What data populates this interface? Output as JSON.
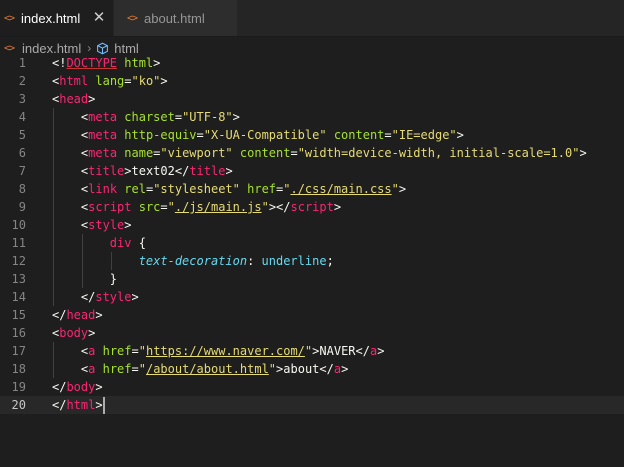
{
  "tabs": [
    {
      "label": "index.html",
      "active": true,
      "icon": "html-file-icon"
    },
    {
      "label": "about.html",
      "active": false,
      "icon": "html-file-icon"
    }
  ],
  "breadcrumb": {
    "file": "index.html",
    "symbol": "html"
  },
  "editor": {
    "current_line": 20,
    "lines": [
      [
        {
          "t": "<!",
          "c": "punc"
        },
        {
          "t": "DOCTYPE",
          "c": "tag"
        },
        {
          "t": " html",
          "c": "attr"
        },
        {
          "t": ">",
          "c": "punc"
        }
      ],
      [
        {
          "t": "<",
          "c": "punc"
        },
        {
          "t": "html",
          "c": "tag"
        },
        {
          "t": " lang",
          "c": "attr"
        },
        {
          "t": "=",
          "c": "punc"
        },
        {
          "t": "\"ko\"",
          "c": "str"
        },
        {
          "t": ">",
          "c": "punc"
        }
      ],
      [
        {
          "t": "<",
          "c": "punc"
        },
        {
          "t": "head",
          "c": "tag"
        },
        {
          "t": ">",
          "c": "punc"
        }
      ],
      [
        {
          "t": "    ",
          "c": "text"
        },
        {
          "t": "<",
          "c": "punc"
        },
        {
          "t": "meta",
          "c": "tag"
        },
        {
          "t": " charset",
          "c": "attr"
        },
        {
          "t": "=",
          "c": "punc"
        },
        {
          "t": "\"UTF-8\"",
          "c": "str"
        },
        {
          "t": ">",
          "c": "punc"
        }
      ],
      [
        {
          "t": "    ",
          "c": "text"
        },
        {
          "t": "<",
          "c": "punc"
        },
        {
          "t": "meta",
          "c": "tag"
        },
        {
          "t": " http-equiv",
          "c": "attr"
        },
        {
          "t": "=",
          "c": "punc"
        },
        {
          "t": "\"X-UA-Compatible\"",
          "c": "str"
        },
        {
          "t": " content",
          "c": "attr"
        },
        {
          "t": "=",
          "c": "punc"
        },
        {
          "t": "\"IE=edge\"",
          "c": "str"
        },
        {
          "t": ">",
          "c": "punc"
        }
      ],
      [
        {
          "t": "    ",
          "c": "text"
        },
        {
          "t": "<",
          "c": "punc"
        },
        {
          "t": "meta",
          "c": "tag"
        },
        {
          "t": " name",
          "c": "attr"
        },
        {
          "t": "=",
          "c": "punc"
        },
        {
          "t": "\"viewport\"",
          "c": "str"
        },
        {
          "t": " content",
          "c": "attr"
        },
        {
          "t": "=",
          "c": "punc"
        },
        {
          "t": "\"width=device-width, initial-scale=1.0\"",
          "c": "str"
        },
        {
          "t": ">",
          "c": "punc"
        }
      ],
      [
        {
          "t": "    ",
          "c": "text"
        },
        {
          "t": "<",
          "c": "punc"
        },
        {
          "t": "title",
          "c": "tag"
        },
        {
          "t": ">",
          "c": "punc"
        },
        {
          "t": "text02",
          "c": "text"
        },
        {
          "t": "</",
          "c": "punc"
        },
        {
          "t": "title",
          "c": "tag"
        },
        {
          "t": ">",
          "c": "punc"
        }
      ],
      [
        {
          "t": "    ",
          "c": "text"
        },
        {
          "t": "<",
          "c": "punc"
        },
        {
          "t": "link",
          "c": "tag"
        },
        {
          "t": " rel",
          "c": "attr"
        },
        {
          "t": "=",
          "c": "punc"
        },
        {
          "t": "\"stylesheet\"",
          "c": "str"
        },
        {
          "t": " href",
          "c": "attr"
        },
        {
          "t": "=",
          "c": "punc"
        },
        {
          "t": "\"",
          "c": "str"
        },
        {
          "t": "./css/main.css",
          "c": "str link"
        },
        {
          "t": "\"",
          "c": "str"
        },
        {
          "t": ">",
          "c": "punc"
        }
      ],
      [
        {
          "t": "    ",
          "c": "text"
        },
        {
          "t": "<",
          "c": "punc"
        },
        {
          "t": "script",
          "c": "tag"
        },
        {
          "t": " src",
          "c": "attr"
        },
        {
          "t": "=",
          "c": "punc"
        },
        {
          "t": "\"",
          "c": "str"
        },
        {
          "t": "./js/main.js",
          "c": "str link"
        },
        {
          "t": "\"",
          "c": "str"
        },
        {
          "t": "></",
          "c": "punc"
        },
        {
          "t": "script",
          "c": "tag"
        },
        {
          "t": ">",
          "c": "punc"
        }
      ],
      [
        {
          "t": "    ",
          "c": "text"
        },
        {
          "t": "<",
          "c": "punc"
        },
        {
          "t": "style",
          "c": "tag"
        },
        {
          "t": ">",
          "c": "punc"
        }
      ],
      [
        {
          "t": "        ",
          "c": "text"
        },
        {
          "t": "div",
          "c": "kw"
        },
        {
          "t": " {",
          "c": "punc"
        }
      ],
      [
        {
          "t": "            ",
          "c": "text"
        },
        {
          "t": "text-decoration",
          "c": "prop"
        },
        {
          "t": ": ",
          "c": "punc"
        },
        {
          "t": "underline",
          "c": "val"
        },
        {
          "t": ";",
          "c": "punc"
        }
      ],
      [
        {
          "t": "        ",
          "c": "text"
        },
        {
          "t": "}",
          "c": "punc"
        }
      ],
      [
        {
          "t": "    ",
          "c": "text"
        },
        {
          "t": "</",
          "c": "punc"
        },
        {
          "t": "style",
          "c": "tag"
        },
        {
          "t": ">",
          "c": "punc"
        }
      ],
      [
        {
          "t": "</",
          "c": "punc"
        },
        {
          "t": "head",
          "c": "tag"
        },
        {
          "t": ">",
          "c": "punc"
        }
      ],
      [
        {
          "t": "<",
          "c": "punc"
        },
        {
          "t": "body",
          "c": "tag"
        },
        {
          "t": ">",
          "c": "punc"
        }
      ],
      [
        {
          "t": "    ",
          "c": "text"
        },
        {
          "t": "<",
          "c": "punc"
        },
        {
          "t": "a",
          "c": "tag"
        },
        {
          "t": " href",
          "c": "attr"
        },
        {
          "t": "=",
          "c": "punc"
        },
        {
          "t": "\"",
          "c": "str"
        },
        {
          "t": "https://www.naver.com/",
          "c": "str link"
        },
        {
          "t": "\"",
          "c": "str"
        },
        {
          "t": ">",
          "c": "punc"
        },
        {
          "t": "NAVER",
          "c": "text"
        },
        {
          "t": "</",
          "c": "punc"
        },
        {
          "t": "a",
          "c": "tag"
        },
        {
          "t": ">",
          "c": "punc"
        }
      ],
      [
        {
          "t": "    ",
          "c": "text"
        },
        {
          "t": "<",
          "c": "punc"
        },
        {
          "t": "a",
          "c": "tag"
        },
        {
          "t": " href",
          "c": "attr"
        },
        {
          "t": "=",
          "c": "punc"
        },
        {
          "t": "\"",
          "c": "str"
        },
        {
          "t": "/about/about.html",
          "c": "str link"
        },
        {
          "t": "\"",
          "c": "str"
        },
        {
          "t": ">",
          "c": "punc"
        },
        {
          "t": "about",
          "c": "text"
        },
        {
          "t": "</",
          "c": "punc"
        },
        {
          "t": "a",
          "c": "tag"
        },
        {
          "t": ">",
          "c": "punc"
        }
      ],
      [
        {
          "t": "</",
          "c": "punc"
        },
        {
          "t": "body",
          "c": "tag"
        },
        {
          "t": ">",
          "c": "punc"
        }
      ],
      [
        {
          "t": "</",
          "c": "punc"
        },
        {
          "t": "html",
          "c": "tag"
        },
        {
          "t": ">",
          "c": "punc"
        }
      ]
    ]
  },
  "colors": {
    "background": "#1e1e1e",
    "tag": "#f92672",
    "attribute": "#a6e22e",
    "string": "#e6db74",
    "property": "#66d9ef",
    "file_icon": "#e37933"
  }
}
